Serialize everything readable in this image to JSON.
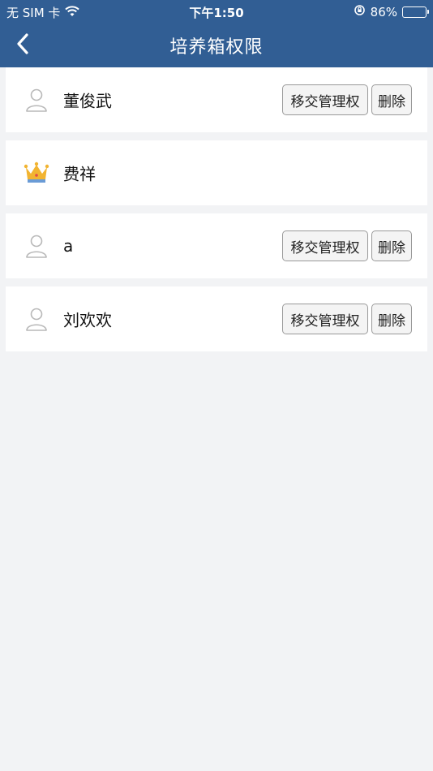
{
  "status_bar": {
    "carrier": "无 SIM 卡",
    "time": "下午1:50",
    "battery_percent": "86%",
    "battery_level": 0.86
  },
  "nav": {
    "title": "培养箱权限"
  },
  "members": [
    {
      "name": "董俊武",
      "role": "member",
      "transfer_label": "移交管理权",
      "delete_label": "删除"
    },
    {
      "name": "费祥",
      "role": "admin"
    },
    {
      "name": "a",
      "role": "member",
      "transfer_label": "移交管理权",
      "delete_label": "删除"
    },
    {
      "name": "刘欢欢",
      "role": "member",
      "transfer_label": "移交管理权",
      "delete_label": "删除"
    }
  ],
  "colors": {
    "header_bg": "#315e94",
    "page_bg": "#f2f3f5",
    "crown": "#f2b431"
  },
  "icons": {
    "back": "chevron-left-icon",
    "member_avatar": "user-outline-icon",
    "admin_avatar": "crown-icon"
  }
}
